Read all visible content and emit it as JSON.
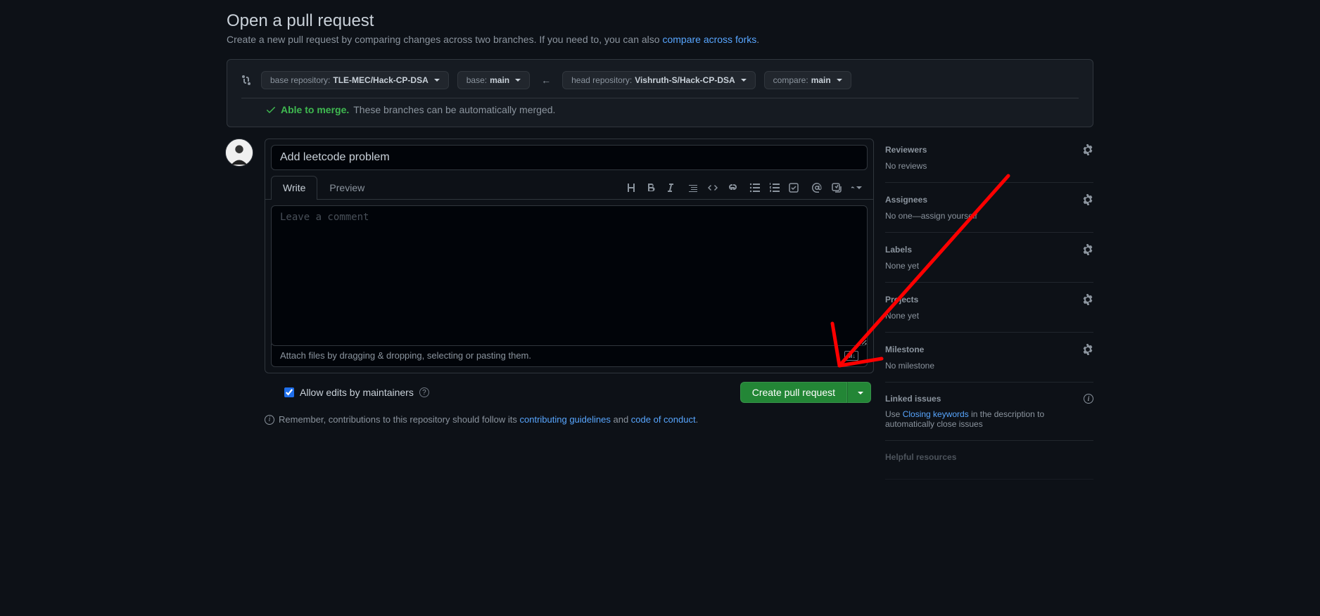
{
  "header": {
    "title": "Open a pull request",
    "description": "Create a new pull request by comparing changes across two branches. If you need to, you can also ",
    "compare_forks_link": "compare across forks"
  },
  "compare": {
    "base_repo_label": "base repository:",
    "base_repo_value": "TLE-MEC/Hack-CP-DSA",
    "base_branch_label": "base:",
    "base_branch_value": "main",
    "head_repo_label": "head repository:",
    "head_repo_value": "Vishruth-S/Hack-CP-DSA",
    "compare_branch_label": "compare:",
    "compare_branch_value": "main",
    "merge_able": "Able to merge.",
    "merge_rest": "These branches can be automatically merged."
  },
  "form": {
    "title_value": "Add leetcode problem",
    "tabs": {
      "write": "Write",
      "preview": "Preview"
    },
    "body_placeholder": "Leave a comment",
    "attach_text": "Attach files by dragging & dropping, selecting or pasting them.",
    "markdown_badge": "M↓",
    "allow_edits": "Allow edits by maintainers",
    "create_button": "Create pull request",
    "footer_prefix": "Remember, contributions to this repository should follow its ",
    "footer_link1": "contributing guidelines",
    "footer_mid": " and ",
    "footer_link2": "code of conduct"
  },
  "sidebar": {
    "reviewers": {
      "title": "Reviewers",
      "content": "No reviews"
    },
    "assignees": {
      "title": "Assignees",
      "content_prefix": "No one—",
      "self_link": "assign yourself"
    },
    "labels": {
      "title": "Labels",
      "content": "None yet"
    },
    "projects": {
      "title": "Projects",
      "content": "None yet"
    },
    "milestone": {
      "title": "Milestone",
      "content": "No milestone"
    },
    "linked": {
      "title": "Linked issues",
      "content_prefix": "Use ",
      "link": "Closing keywords",
      "content_suffix": " in the description to automatically close issues"
    },
    "helpful": {
      "title": "Helpful resources"
    }
  }
}
